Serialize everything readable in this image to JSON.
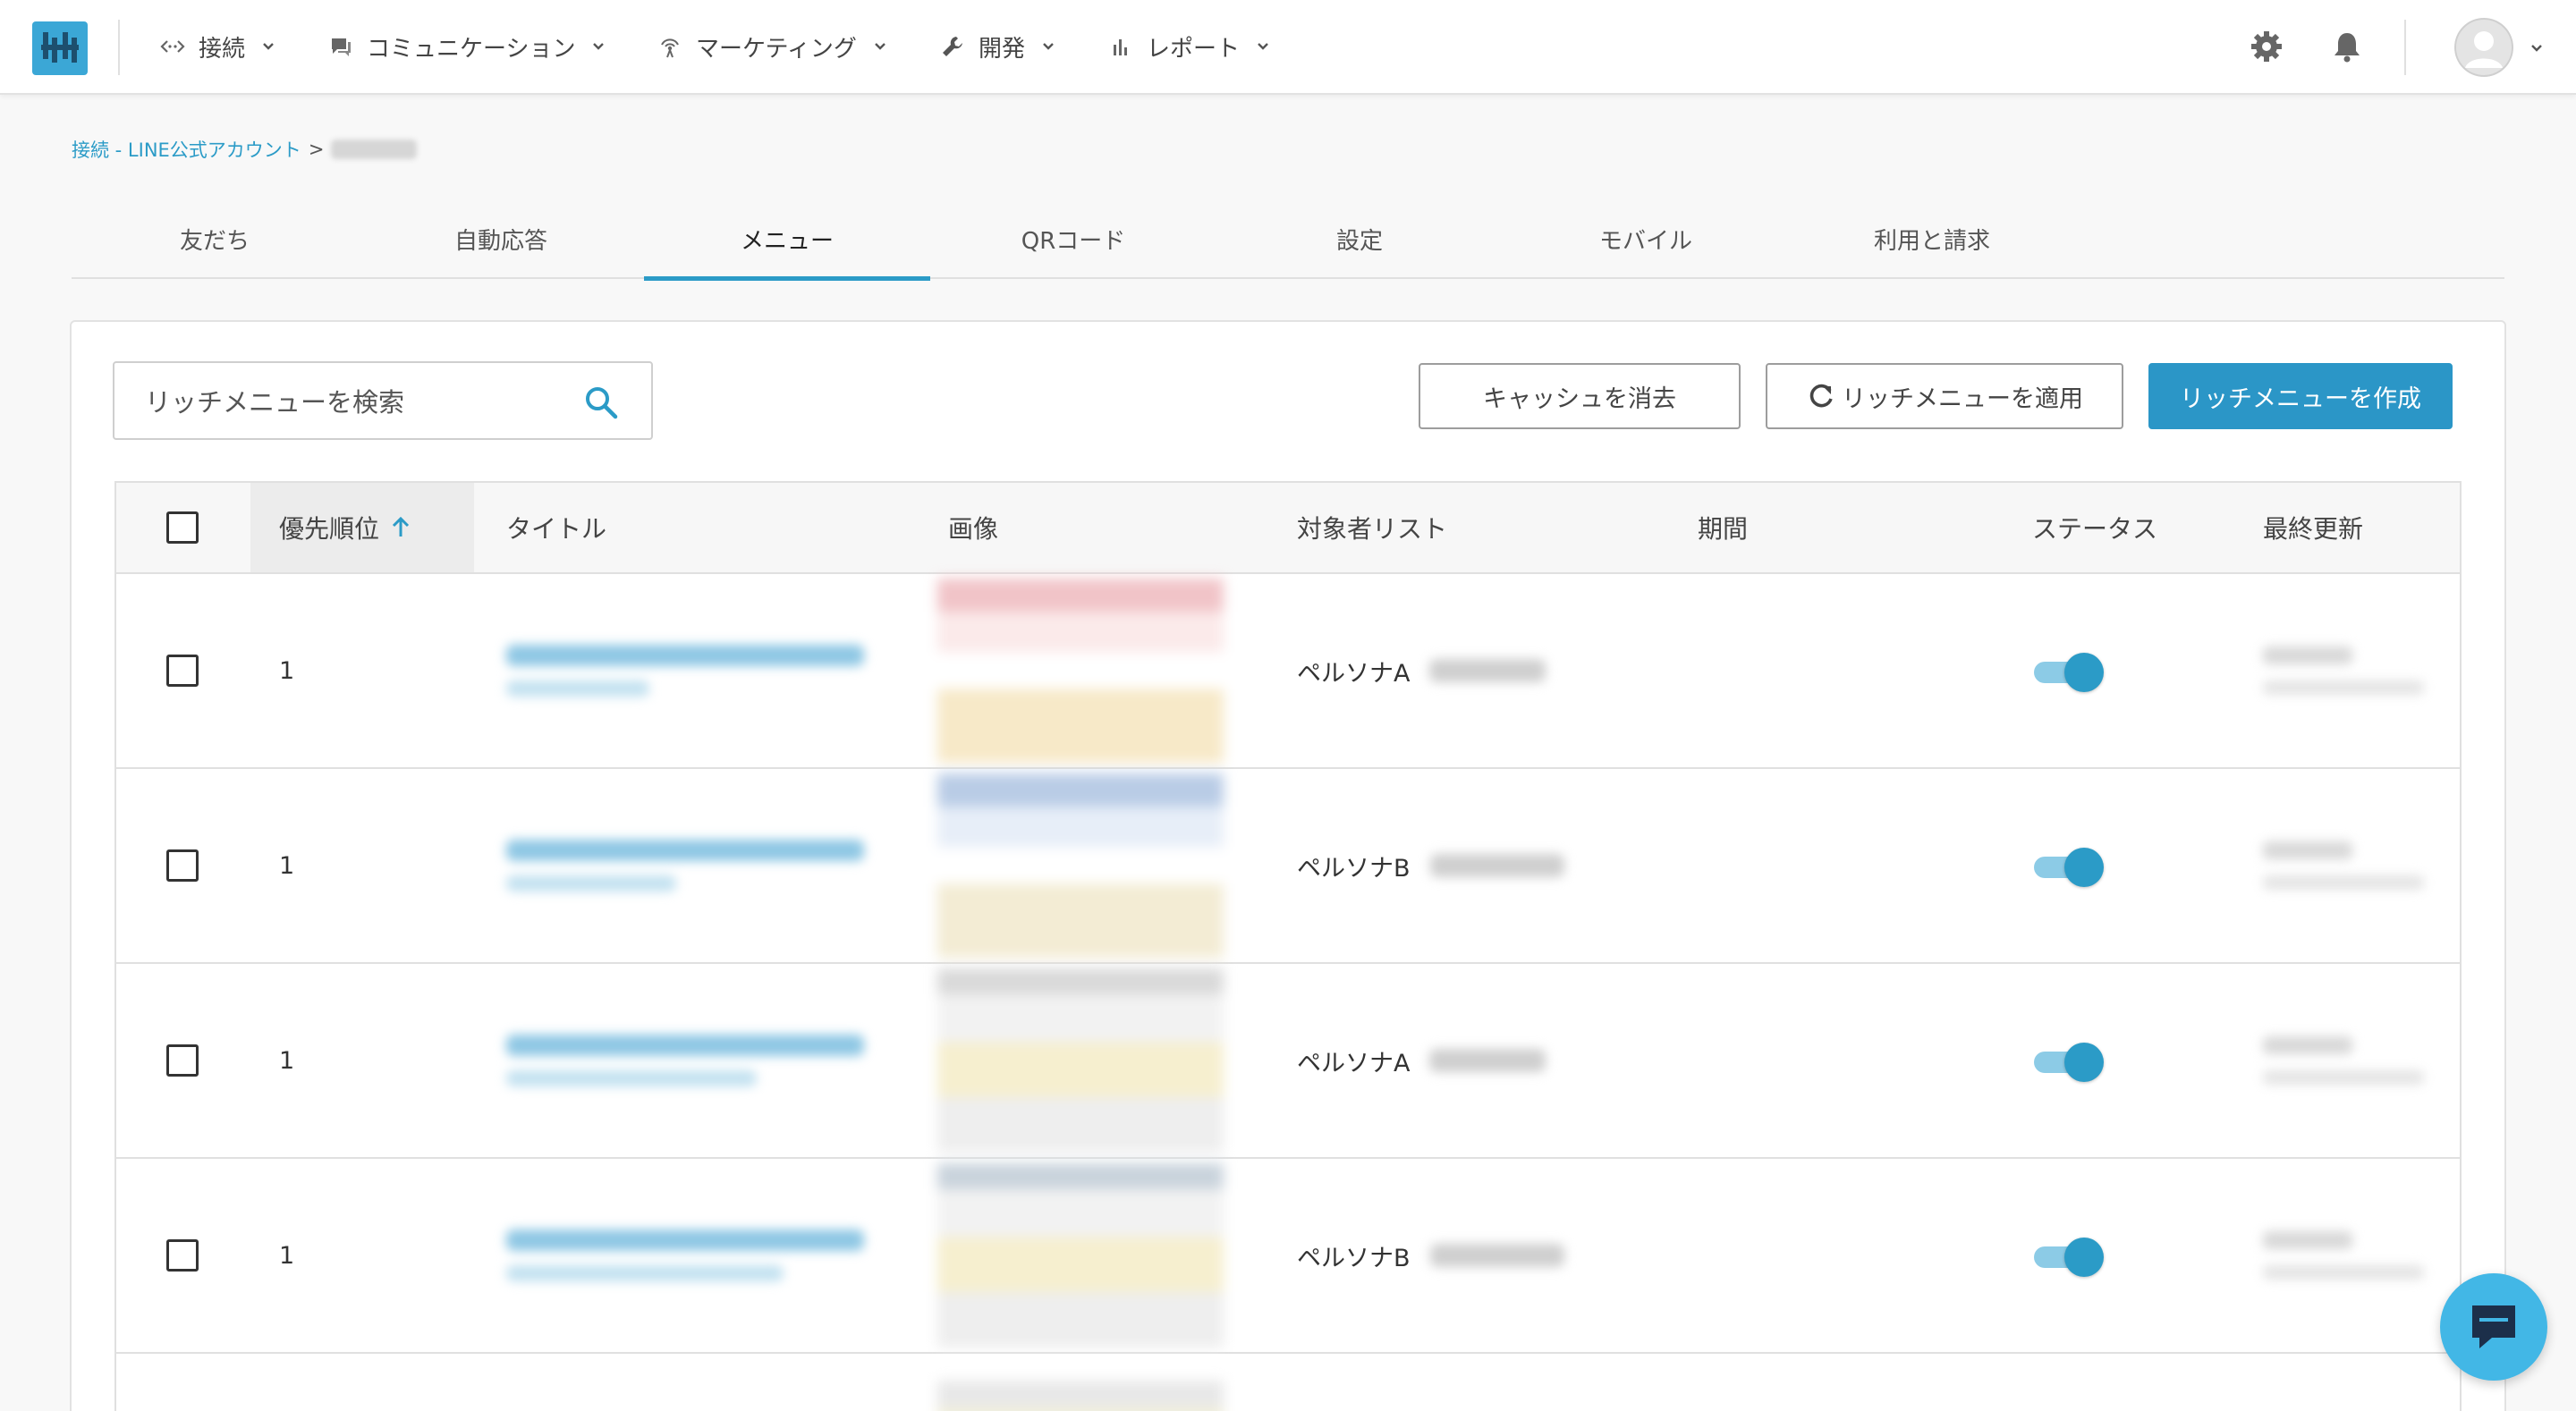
{
  "nav": {
    "items": [
      {
        "label": "接続",
        "icon": "connection-icon"
      },
      {
        "label": "コミュニケーション",
        "icon": "chat-icon"
      },
      {
        "label": "マーケティング",
        "icon": "broadcast-icon"
      },
      {
        "label": "開発",
        "icon": "wrench-icon"
      },
      {
        "label": "レポート",
        "icon": "bar-chart-icon"
      }
    ],
    "right_icons": [
      "gear-icon",
      "bell-icon",
      "avatar-icon"
    ]
  },
  "breadcrumb": {
    "link": "接続 - LINE公式アカウント",
    "separator": ">"
  },
  "tabs": [
    "友だち",
    "自動応答",
    "メニュー",
    "QRコード",
    "設定",
    "モバイル",
    "利用と請求"
  ],
  "active_tab": "メニュー",
  "toolbar": {
    "search_placeholder": "リッチメニューを検索",
    "clear_cache": "キャッシュを消去",
    "apply": "リッチメニューを適用",
    "create": "リッチメニューを作成"
  },
  "table": {
    "headers": {
      "priority": "優先順位",
      "title": "タイトル",
      "image": "画像",
      "audience": "対象者リスト",
      "period": "期間",
      "status": "ステータス",
      "updated": "最終更新"
    },
    "rows": [
      {
        "priority": "1",
        "audience": "ペルソナA",
        "status_on": true
      },
      {
        "priority": "1",
        "audience": "ペルソナB",
        "status_on": true
      },
      {
        "priority": "1",
        "audience": "ペルソナA",
        "status_on": true
      },
      {
        "priority": "1",
        "audience": "ペルソナB",
        "status_on": true
      }
    ]
  },
  "colors": {
    "accent": "#2b9bc7",
    "primary_button": "#2b96c7",
    "chat_fab": "#42b7e6"
  }
}
